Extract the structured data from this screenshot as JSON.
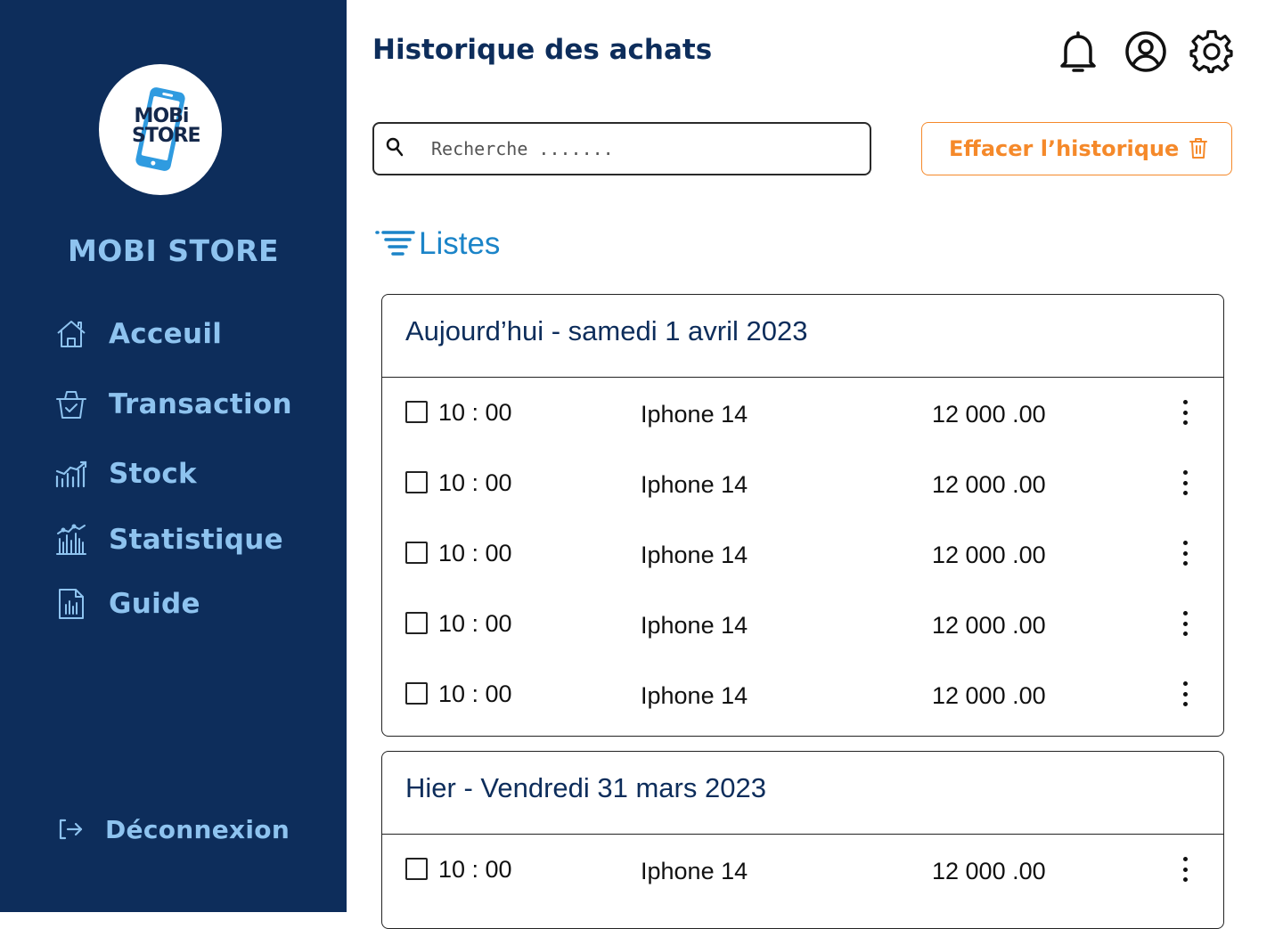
{
  "brand": {
    "logo_text_line1": "MOBi",
    "logo_text_line2": "STORE",
    "name": "MOBI STORE"
  },
  "sidebar": {
    "items": [
      {
        "label": "Acceuil",
        "icon": "home-icon"
      },
      {
        "label": "Transaction",
        "icon": "basket-check-icon"
      },
      {
        "label": "Stock",
        "icon": "bar-chart-trend-icon"
      },
      {
        "label": "Statistique",
        "icon": "building-chart-icon"
      },
      {
        "label": "Guide",
        "icon": "document-chart-icon"
      }
    ],
    "logout_label": "Déconnexion"
  },
  "header": {
    "title": "Historique des achats",
    "icons": [
      "bell-icon",
      "user-circle-icon",
      "gear-icon"
    ]
  },
  "search": {
    "placeholder": "Recherche ......."
  },
  "actions": {
    "clear_history_label": "Effacer l’historique"
  },
  "list_header": {
    "label": "Listes"
  },
  "groups": [
    {
      "title": "Aujourd’hui - samedi 1 avril 2023",
      "rows": [
        {
          "time": "10 : 00",
          "product": "Iphone 14",
          "price": "12 000 .00"
        },
        {
          "time": "10 : 00",
          "product": "Iphone 14",
          "price": "12 000 .00"
        },
        {
          "time": "10 : 00",
          "product": "Iphone 14",
          "price": "12 000 .00"
        },
        {
          "time": "10 : 00",
          "product": "Iphone 14",
          "price": "12 000 .00"
        },
        {
          "time": "10 : 00",
          "product": "Iphone 14",
          "price": "12 000 .00"
        }
      ]
    },
    {
      "title": "Hier - Vendredi 31 mars 2023",
      "rows": [
        {
          "time": "10 : 00",
          "product": "Iphone 14",
          "price": "12 000 .00"
        }
      ]
    }
  ],
  "colors": {
    "sidebar_bg": "#0d2d5b",
    "sidebar_text": "#8ec3ef",
    "title": "#0d2d5b",
    "accent_orange": "#f5892a",
    "accent_blue": "#1b84c8"
  }
}
